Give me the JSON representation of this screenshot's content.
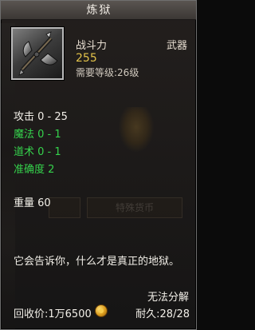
{
  "title": "炼狱",
  "item": {
    "label": "战斗力",
    "value": "255",
    "type": "武器",
    "requirement": "需要等级:26级"
  },
  "stats": [
    {
      "text": "攻击 0 - 25",
      "color": "#f2efe8"
    },
    {
      "text": "魔法 0 - 1",
      "color": "#35d24c"
    },
    {
      "text": "道术 0 - 1",
      "color": "#35d24c"
    },
    {
      "text": "准确度 2",
      "color": "#35d24c"
    }
  ],
  "background_button": "特殊货币",
  "weight": "重量 60",
  "description": "它会告诉你，什么才是真正的地狱。",
  "unrepairable": "无法分解",
  "price": "回收价:1万6500",
  "durability": "耐久:28/28"
}
